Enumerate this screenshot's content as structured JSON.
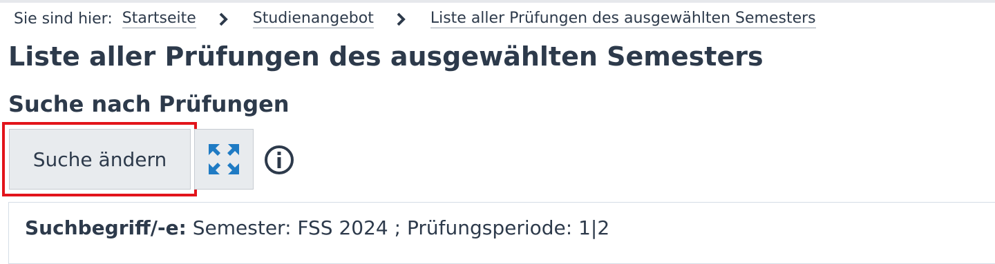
{
  "breadcrumb": {
    "prefix": "Sie sind hier:",
    "items": [
      "Startseite",
      "Studienangebot",
      "Liste aller Prüfungen des ausgewählten Semesters"
    ]
  },
  "page": {
    "title": "Liste aller Prüfungen des ausgewählten Semesters"
  },
  "search": {
    "heading": "Suche nach Prüfungen",
    "change_button_label": "Suche ändern",
    "expand_icon": "expand-arrows-icon",
    "info_icon": "info-icon",
    "summary_label": "Suchbegriff/-e:",
    "summary_value": "Semester: FSS 2024 ;  Prüfungsperiode: 1|2"
  },
  "colors": {
    "text": "#2d3a4b",
    "highlight": "#e2141b",
    "button_bg": "#e8ebee",
    "icon_blue": "#1f7bc4"
  }
}
